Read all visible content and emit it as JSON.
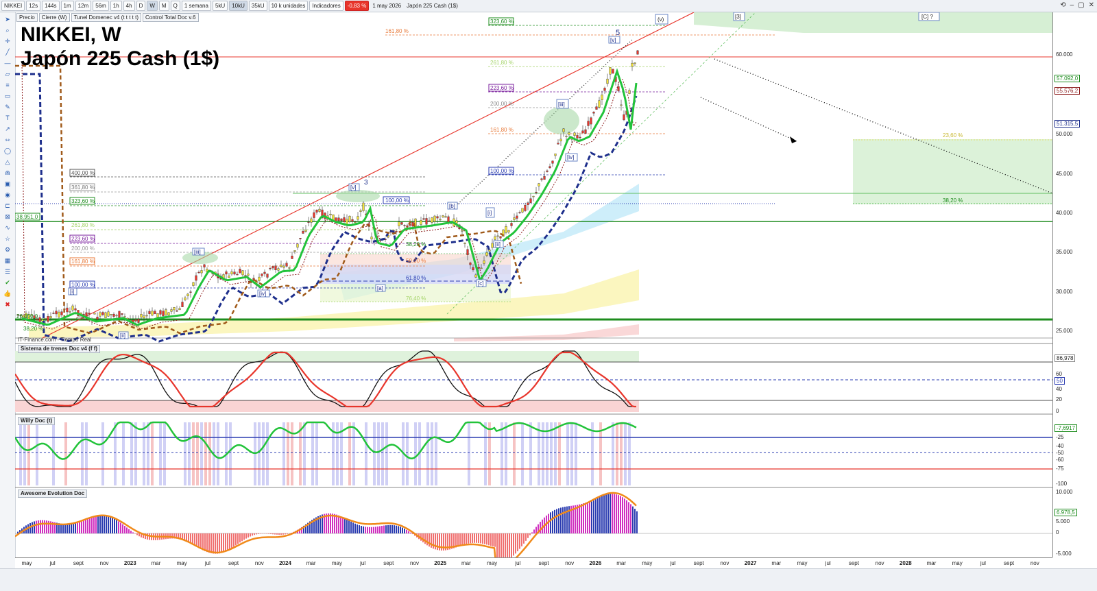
{
  "toolbar": {
    "symbol": "NIKKEI",
    "timeframes": [
      "12s",
      "144s",
      "1m",
      "12m",
      "56m",
      "1h",
      "4h",
      "D",
      "W",
      "M",
      "Q"
    ],
    "active_timeframe": "W",
    "period": "1 semana",
    "units": [
      "5kU",
      "10kU",
      "35kU"
    ],
    "active_units": "10kU",
    "units_select": "10 k unidades",
    "indicators": "Indicadores",
    "change": "-0,83 %",
    "date": "1 may 2026",
    "instrument": "Japón 225 Cash (1$)"
  },
  "legend": [
    "Precio",
    "Cierre (W)",
    "Tunel Domenec v4 (t t t t t)",
    "Control Total Doc v.6"
  ],
  "title": {
    "line1": "NIKKEI, W",
    "line2": "Japón 225 Cash (1$)"
  },
  "watermark": "IT-Finance.com - Tiempo Real",
  "panels": {
    "p1": "Sistema de trenes Doc v4 (f f)",
    "p2": "Willy Doc (t)",
    "p3": "Awesome Evolution Doc"
  },
  "price_scale": [
    "60.000",
    "55.000",
    "50.000",
    "45.000",
    "40.000",
    "35.000",
    "30.000",
    "25.000"
  ],
  "price_tags": {
    "a": "57.092,0",
    "b": "55.576,2",
    "c": "51.315,5"
  },
  "left_tags": {
    "a": "38.951,0",
    "b": "26.450,0"
  },
  "osc1_scale": [
    "80",
    "60",
    "40",
    "20",
    "0"
  ],
  "osc1_tags": {
    "a": "86,978",
    "b": "50"
  },
  "osc2_scale": [
    "-25",
    "-40",
    "-50",
    "-60",
    "-75",
    "-100"
  ],
  "osc2_tags": {
    "a": "-7,6917"
  },
  "osc3_scale": [
    "10.000",
    "5.000",
    "0",
    "-5.000"
  ],
  "osc3_tags": {
    "a": "6.978,5"
  },
  "fib_left": [
    "400,00 %",
    "361,80 %",
    "323,60 %",
    "261,80 %",
    "223,60 %",
    "200,00 %",
    "161,80 %",
    "100,00 %",
    "38,20 %"
  ],
  "fib_right": [
    "323,60 %",
    "161,80 %",
    "261,80 %",
    "223,60 %",
    "200,00 %",
    "161,80 %",
    "100,00 %"
  ],
  "fib_mid": [
    "100,00 %",
    "38,20 %",
    "50,00 %",
    "61,80 %",
    "76,40 %"
  ],
  "fib_future": [
    "23,60 %",
    "38,20 %"
  ],
  "waves": [
    "[i]",
    "[ii]",
    "[iii]",
    "[iv]",
    "[v]",
    "3",
    "[a]",
    "[b]",
    "[i]",
    "[ii]",
    "[iii]",
    "[iv]",
    "[v]",
    "5",
    "(v)",
    "[3]",
    "[C] ?",
    "[c]"
  ],
  "time_ticks": [
    "may",
    "jul",
    "sept",
    "nov",
    "2023",
    "mar",
    "may",
    "jul",
    "sept",
    "nov",
    "2024",
    "mar",
    "may",
    "jul",
    "sept",
    "nov",
    "2025",
    "mar",
    "may",
    "jul",
    "sept",
    "nov",
    "2026",
    "mar",
    "may",
    "jul",
    "sept",
    "nov",
    "2027",
    "mar",
    "may",
    "jul",
    "sept",
    "nov",
    "2028",
    "mar",
    "may",
    "jul",
    "sept",
    "nov"
  ],
  "colors": {
    "ema_green": "#22c33a",
    "ema_dark": "#8b1a1a",
    "ma_blue": "#1e2f8c",
    "trend_red": "#e8352b",
    "hline_green": "#1e8c1e"
  }
}
